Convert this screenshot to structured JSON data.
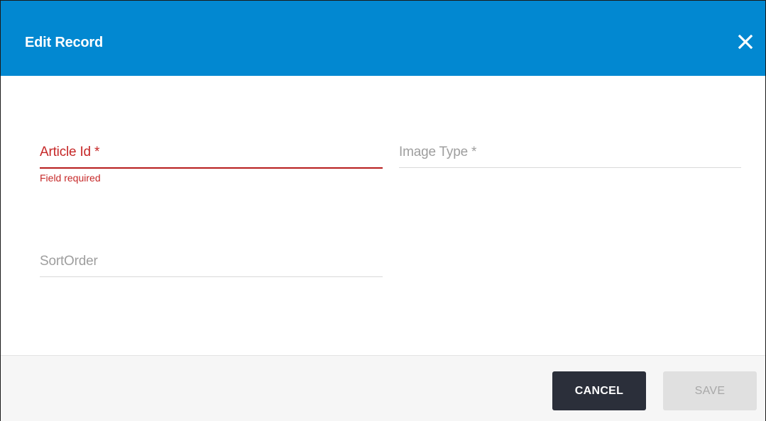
{
  "dialog": {
    "title": "Edit Record",
    "close_icon": "close-icon"
  },
  "form": {
    "article_id": {
      "label": "Article Id *",
      "value": "",
      "error": "Field required"
    },
    "image_type": {
      "label": "Image Type *",
      "value": ""
    },
    "sort_order": {
      "label": "SortOrder",
      "value": ""
    }
  },
  "footer": {
    "cancel_label": "CANCEL",
    "save_label": "SAVE"
  },
  "colors": {
    "header": "#0288d1",
    "error": "#c62828",
    "cancel_button": "#2b2f3a",
    "save_button_disabled": "#e0e0e0"
  }
}
